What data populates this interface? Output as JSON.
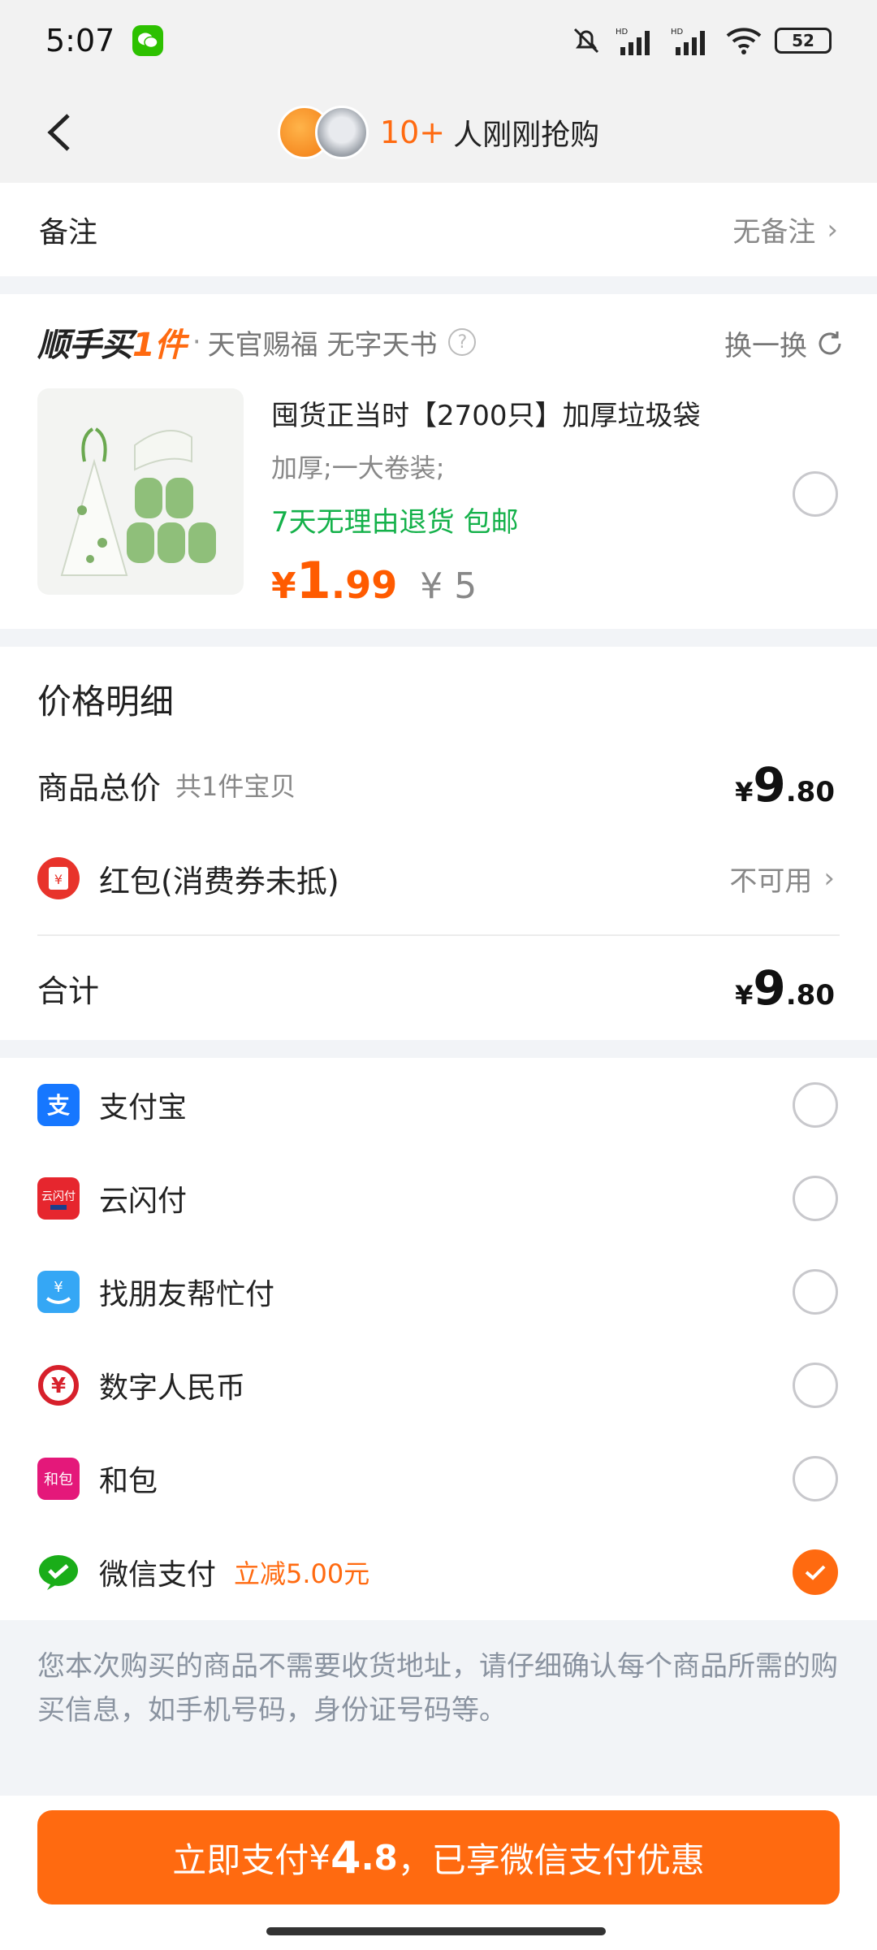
{
  "status_bar": {
    "time": "5:07",
    "battery": "52"
  },
  "header": {
    "count": "10+",
    "text": "人刚刚抢购"
  },
  "remark": {
    "label": "备注",
    "value": "无备注"
  },
  "upsell": {
    "brand_a": "顺手买",
    "brand_b": "1件",
    "subtitle": "天官赐福 无字天书",
    "swap_label": "换一换",
    "product": {
      "title": "囤货正当时【2700只】加厚垃圾袋",
      "spec": "加厚;一大卷装;",
      "tags": "7天无理由退货  包邮",
      "price_symbol": "¥",
      "price_int": "1",
      "price_dec": ".99",
      "original_price": "¥ 5"
    }
  },
  "details": {
    "title": "价格明细",
    "goods_total_label": "商品总价",
    "goods_total_sub": "共1件宝贝",
    "goods_total": {
      "sym": "¥",
      "int": "9",
      "dec": ".80"
    },
    "redpacket_label": "红包(消费券未抵)",
    "redpacket_value": "不可用",
    "total_label": "合计",
    "total": {
      "sym": "¥",
      "int": "9",
      "dec": ".80"
    }
  },
  "payments": [
    {
      "label": "支付宝",
      "icon": "alipay-icon",
      "selected": false
    },
    {
      "label": "云闪付",
      "icon": "unionpay-icon",
      "selected": false
    },
    {
      "label": "找朋友帮忙付",
      "icon": "friend-pay-icon",
      "selected": false
    },
    {
      "label": "数字人民币",
      "icon": "e-cny-icon",
      "selected": false
    },
    {
      "label": "和包",
      "icon": "hebao-icon",
      "selected": false
    },
    {
      "label": "微信支付",
      "icon": "wechat-pay-icon",
      "selected": true,
      "promo": "立减5.00元"
    }
  ],
  "notice": "您本次购买的商品不需要收货地址，请仔细确认每个商品所需的购买信息，如手机号码，身份证号码等。",
  "pay_button": {
    "prefix": "立即支付",
    "sym": "¥",
    "int": "4",
    "dec": ".8",
    "suffix": "，已享微信支付优惠"
  },
  "colors": {
    "accent": "#ff6a10",
    "green": "#14b14a"
  }
}
